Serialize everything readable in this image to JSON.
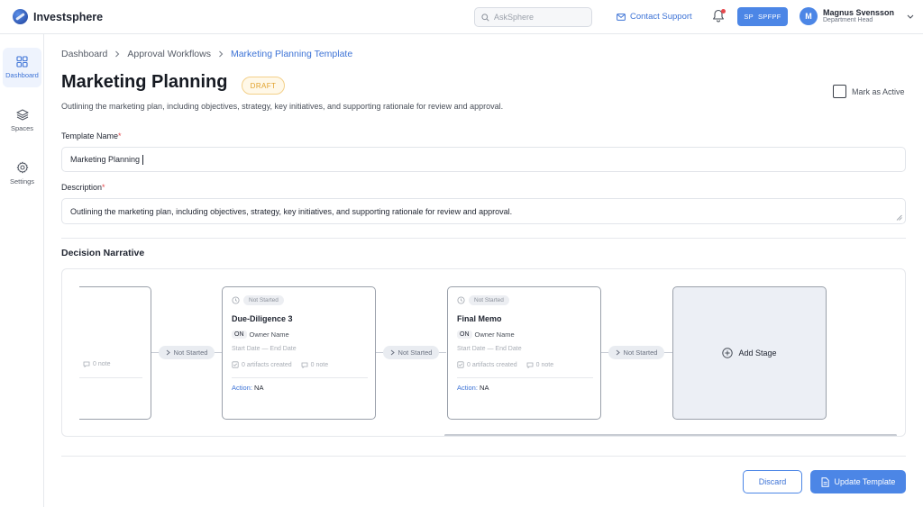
{
  "app": {
    "name": "Investsphere"
  },
  "header": {
    "search_placeholder": "AskSphere",
    "contact_label": "Contact Support",
    "workspace_initials": "SP",
    "workspace_code": "SPFPF",
    "user": {
      "initial": "M",
      "name": "Magnus Svensson",
      "role": "Department Head"
    }
  },
  "sidebar": {
    "items": [
      {
        "label": "Dashboard",
        "icon": "grid-icon",
        "active": true
      },
      {
        "label": "Spaces",
        "icon": "layers-icon",
        "active": false
      },
      {
        "label": "Settings",
        "icon": "gear-icon",
        "active": false
      }
    ]
  },
  "breadcrumb": {
    "items": [
      "Dashboard",
      "Approval Workflows",
      "Marketing Planning Template"
    ]
  },
  "page": {
    "title": "Marketing Planning",
    "status_badge": "DRAFT",
    "subtitle": "Outlining the marketing plan, including objectives, strategy, key initiatives, and supporting rationale for review and approval.",
    "mark_active_label": "Mark as Active",
    "mark_active_checked": false
  },
  "form": {
    "template_name_label": "Template Name",
    "template_name_value": "Marketing Planning",
    "description_label": "Description",
    "description_value": "Outlining the marketing plan, including objectives, strategy, key initiatives, and supporting rationale for review and approval.",
    "required_mark": "*"
  },
  "decision_narrative": {
    "title": "Decision Narrative",
    "partial_stage": {
      "notes": "0 note"
    },
    "stages": [
      {
        "status": "Not Started",
        "name": "Due-Diligence 3",
        "owner_initials": "ON",
        "owner_name": "Owner Name",
        "dates": "Start Date — End Date",
        "artifacts": "0 artifacts created",
        "notes": "0 note",
        "action_label": "Action:",
        "action_value": "NA"
      },
      {
        "status": "Not Started",
        "name": "Final Memo",
        "owner_initials": "ON",
        "owner_name": "Owner Name",
        "dates": "Start Date — End Date",
        "artifacts": "0 artifacts created",
        "notes": "0 note",
        "action_label": "Action:",
        "action_value": "NA"
      }
    ],
    "connectors": [
      "Not Started",
      "Not Started",
      "Not Started"
    ],
    "add_stage_label": "Add Stage"
  },
  "actions": {
    "discard_label": "Discard",
    "update_label": "Update Template"
  },
  "colors": {
    "accent": "#4c86e6",
    "link": "#3d73d6",
    "draft_text": "#e0a12b",
    "required": "#e5484d"
  }
}
